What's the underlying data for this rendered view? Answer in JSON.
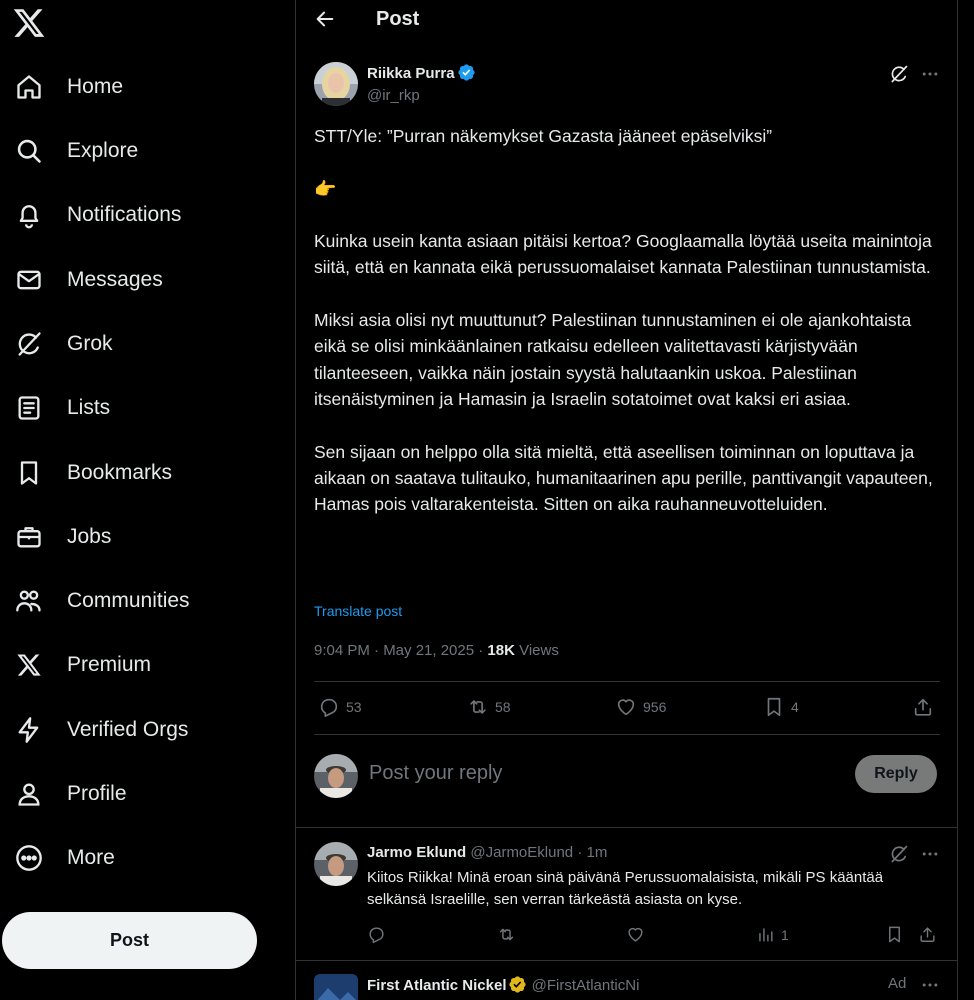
{
  "sidebar": {
    "items": [
      {
        "label": "Home",
        "icon": "home-icon"
      },
      {
        "label": "Explore",
        "icon": "search-icon"
      },
      {
        "label": "Notifications",
        "icon": "bell-icon"
      },
      {
        "label": "Messages",
        "icon": "envelope-icon"
      },
      {
        "label": "Grok",
        "icon": "grok-icon"
      },
      {
        "label": "Lists",
        "icon": "list-icon"
      },
      {
        "label": "Bookmarks",
        "icon": "bookmark-icon"
      },
      {
        "label": "Jobs",
        "icon": "briefcase-icon"
      },
      {
        "label": "Communities",
        "icon": "communities-icon"
      },
      {
        "label": "Premium",
        "icon": "x-logo-icon"
      },
      {
        "label": "Verified Orgs",
        "icon": "lightning-icon"
      },
      {
        "label": "Profile",
        "icon": "person-icon"
      },
      {
        "label": "More",
        "icon": "more-circle-icon"
      }
    ],
    "post_button": "Post"
  },
  "header": {
    "title": "Post"
  },
  "tweet": {
    "author_name": "Riikka Purra",
    "author_handle": "@ir_rkp",
    "paragraphs": [
      "STT/Yle: ”Purran näkemykset Gazasta jääneet epäselviksi”",
      "👉",
      "Kuinka usein kanta asiaan pitäisi kertoa? Googlaamalla löytää useita mainintoja siitä, että en kannata eikä perussuomalaiset kannata Palestiinan tunnustamista.",
      "Miksi asia olisi nyt muuttunut? Palestiinan tunnustaminen ei ole ajankohtaista eikä se olisi minkäänlainen ratkaisu edelleen valitettavasti kärjistyvään tilanteeseen, vaikka näin jostain syystä halutaankin uskoa. Palestiinan itsenäistyminen ja Hamasin ja Israelin sotatoimet ovat kaksi eri asiaa.",
      "Sen sijaan on helppo olla sitä mieltä, että aseellisen toiminnan on loputtava ja aikaan on saatava tulitauko, humanitaarinen apu perille, panttivangit vapauteen, Hamas pois valtarakenteista. Sitten on aika rauhanneuvotteluiden."
    ],
    "translate": "Translate post",
    "timestamp": "9:04 PM · May 21, 2025 · ",
    "views_count": "18K",
    "views_label": " Views",
    "replies": "53",
    "reposts": "58",
    "likes": "956",
    "bookmarks": "4"
  },
  "composer": {
    "placeholder": "Post your reply",
    "reply_button": "Reply"
  },
  "reply": {
    "author_name": "Jarmo Eklund",
    "author_handle": "@JarmoEklund",
    "time": " · 1m",
    "text": "Kiitos Riikka! Minä eroan sinä päivänä Perussuomalaisista, mikäli PS kääntää selkänsä Israelille, sen verran tärkeästä asiasta on kyse.",
    "views": "1"
  },
  "ad": {
    "author_name": "First Atlantic Nickel",
    "author_handle": "@FirstAtlanticNi",
    "ad_label": "Ad"
  },
  "colors": {
    "accent": "#1d9bf0",
    "gold": "#e2b719",
    "background": "#000000"
  }
}
